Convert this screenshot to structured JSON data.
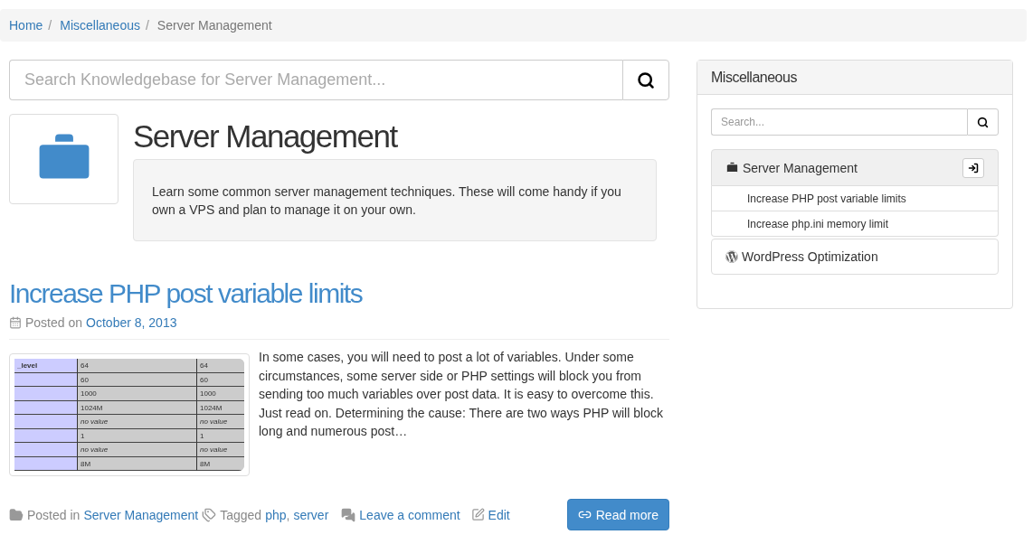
{
  "breadcrumb_separator": "/",
  "breadcrumb": [
    {
      "label": "Home",
      "current": false
    },
    {
      "label": "Miscellaneous",
      "current": false
    },
    {
      "label": "Server Management",
      "current": true
    }
  ],
  "search": {
    "placeholder": "Search Knowledgebase for Server Management..."
  },
  "category": {
    "title": "Server Management",
    "description": "Learn some common server management techniques. These will come handy if you own a VPS and plan to manage it on your own."
  },
  "post": {
    "title": "Increase PHP post variable limits",
    "posted_on_label": "Posted on",
    "date": "October 8, 2013",
    "thumbnail": {
      "rows": [
        {
          "label": "_level",
          "value_1": "64",
          "value_2": "64",
          "italic": false
        },
        {
          "value_1": "60",
          "value_2": "60",
          "italic": false
        },
        {
          "value_1": "1000",
          "value_2": "1000",
          "italic": false
        },
        {
          "value_1": "1024M",
          "value_2": "1024M",
          "italic": false
        },
        {
          "value_1": "no value",
          "value_2": "no value",
          "italic": true
        },
        {
          "value_1": "1",
          "value_2": "1",
          "italic": false
        },
        {
          "value_1": "no value",
          "value_2": "no value",
          "italic": true
        },
        {
          "value_1": "8M",
          "value_2": "8M",
          "italic": false
        }
      ]
    },
    "excerpt": "In some cases, you will need to post a lot of variables. Under some circumstances, some server side or PHP settings will block you from sending too much variables over post data. It is easy to overcome this. Just read on. Determining the cause: There are two ways PHP will block long and numerous post…",
    "posted_in_label": "Posted in",
    "category_link": "Server Management",
    "tagged_label": "Tagged",
    "tags": [
      "php",
      "server"
    ],
    "tag_separator": ",",
    "comment_link": "Leave a comment",
    "edit_link": "Edit",
    "read_more": "Read more"
  },
  "sidebar": {
    "title": "Miscellaneous",
    "search_placeholder": "Search...",
    "items": [
      {
        "label": "Server Management",
        "kind": "briefcase",
        "expanded": true,
        "children": [
          {
            "label": "Increase PHP post variable limits"
          },
          {
            "label": "Increase php.ini memory limit"
          }
        ]
      },
      {
        "label": "WordPress Optimization",
        "kind": "wordpress",
        "expanded": false
      }
    ]
  }
}
